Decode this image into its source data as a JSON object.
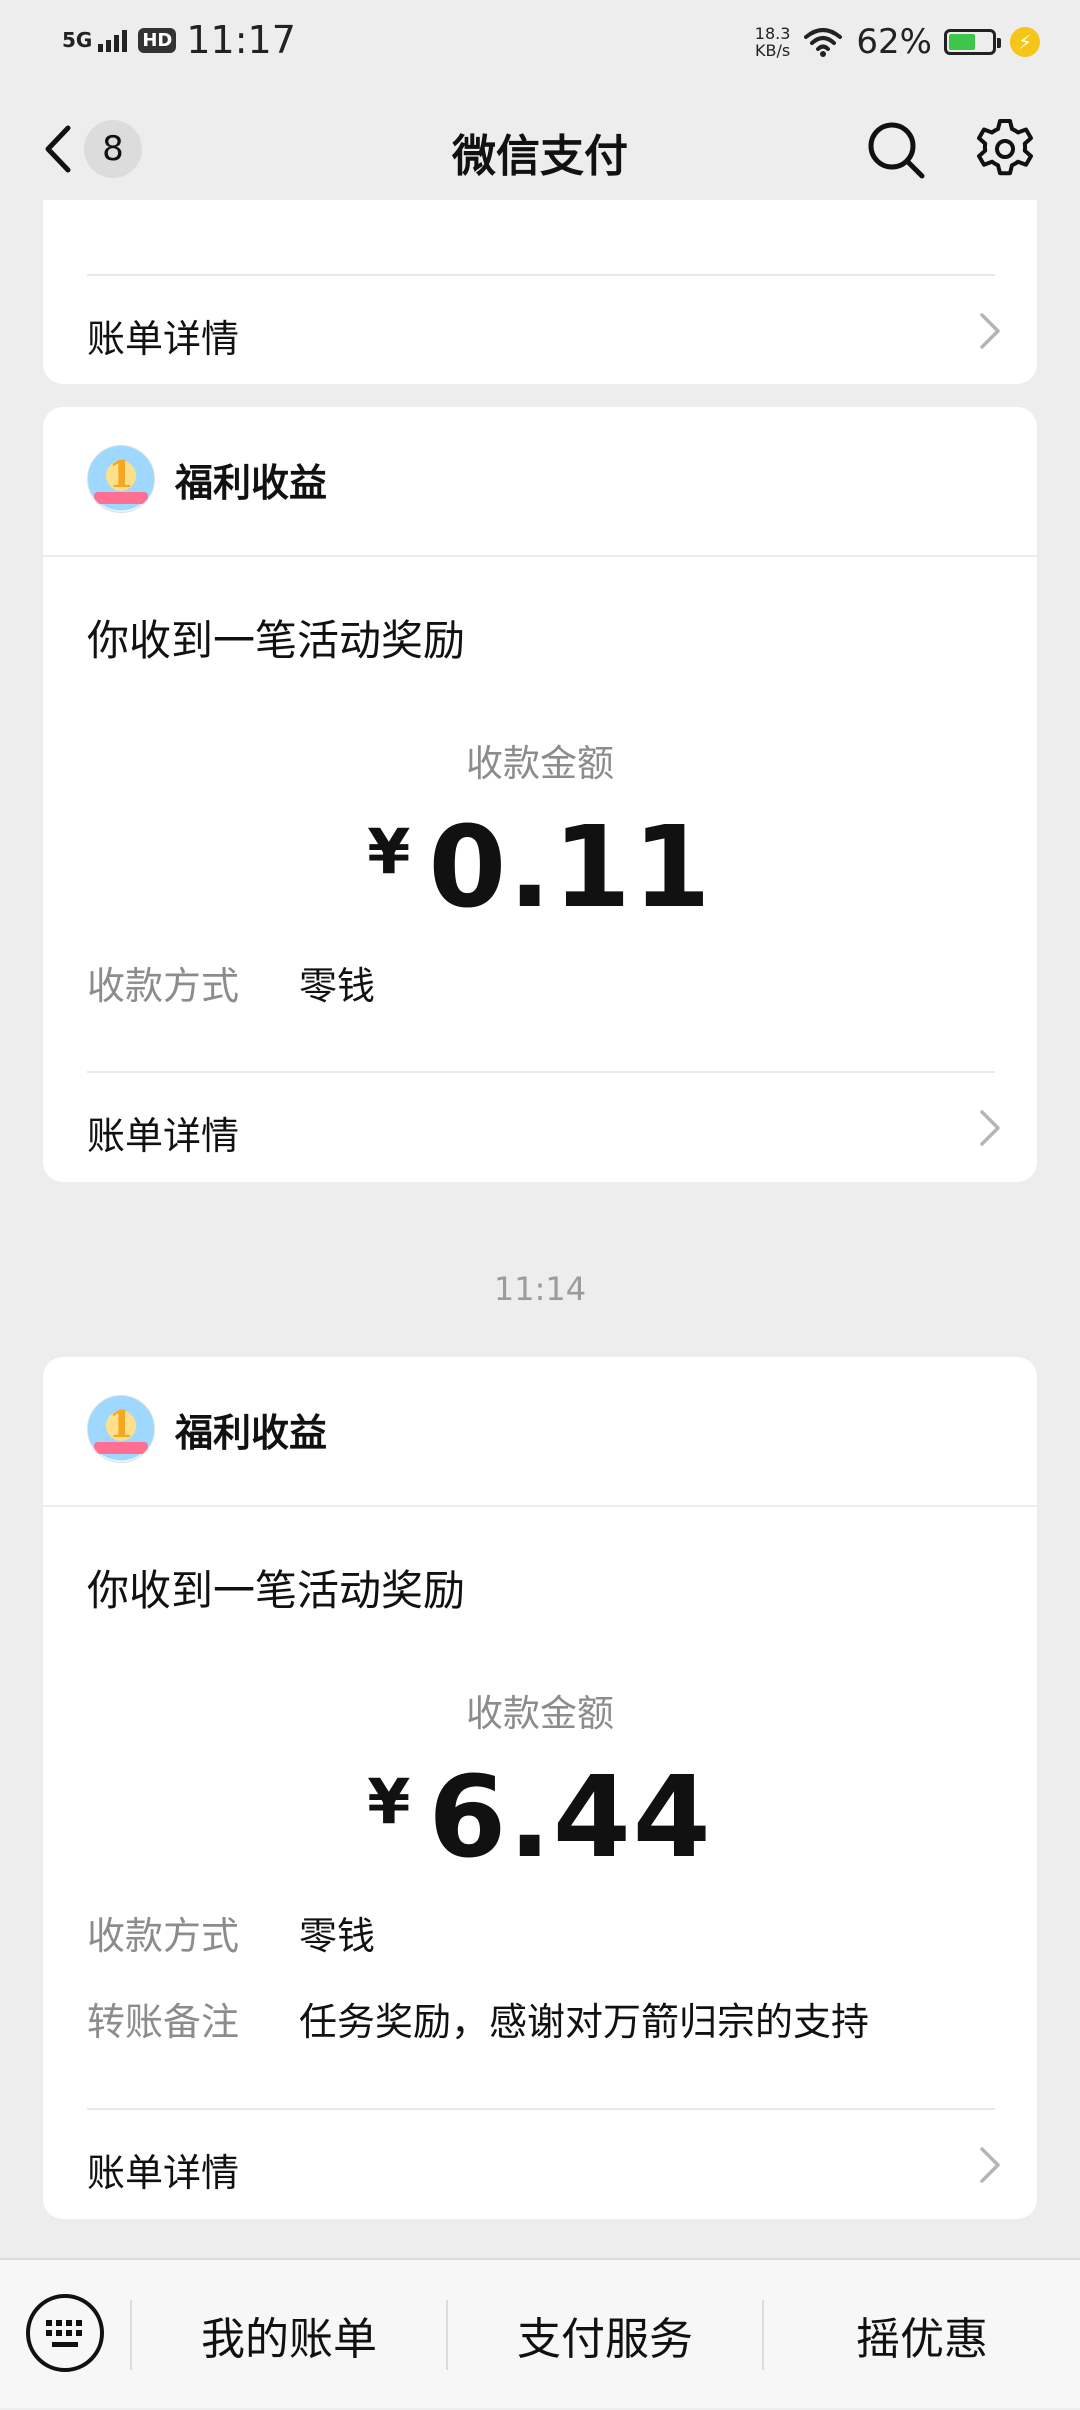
{
  "status_bar": {
    "network": "5G",
    "hd": "HD",
    "time": "11:17",
    "speed_value": "18.3",
    "speed_unit": "KB/s",
    "battery_percent": "62%",
    "battery_level": 0.62,
    "battery_color": "#3ec64a"
  },
  "nav": {
    "back_icon": "chevron-left-icon",
    "unread_count": "8",
    "title": "微信支付",
    "search_icon": "search-icon",
    "settings_icon": "gear-icon"
  },
  "cards": [
    {
      "detail_label": "账单详情"
    },
    {
      "merchant": "福利收益",
      "headline": "你收到一笔活动奖励",
      "amount_label": "收款金额",
      "currency": "¥",
      "amount": "0.11",
      "method_label": "收款方式",
      "method_value": "零钱",
      "detail_label": "账单详情"
    },
    {
      "merchant": "福利收益",
      "headline": "你收到一笔活动奖励",
      "amount_label": "收款金额",
      "currency": "¥",
      "amount": "6.44",
      "method_label": "收款方式",
      "method_value": "零钱",
      "note_label": "转账备注",
      "note_value": "任务奖励，感谢对万箭归宗的支持",
      "detail_label": "账单详情"
    }
  ],
  "timestamp": "11:14",
  "bottom_menu": {
    "keyboard_icon": "keyboard-icon",
    "items": [
      "我的账单",
      "支付服务",
      "摇优惠"
    ]
  }
}
